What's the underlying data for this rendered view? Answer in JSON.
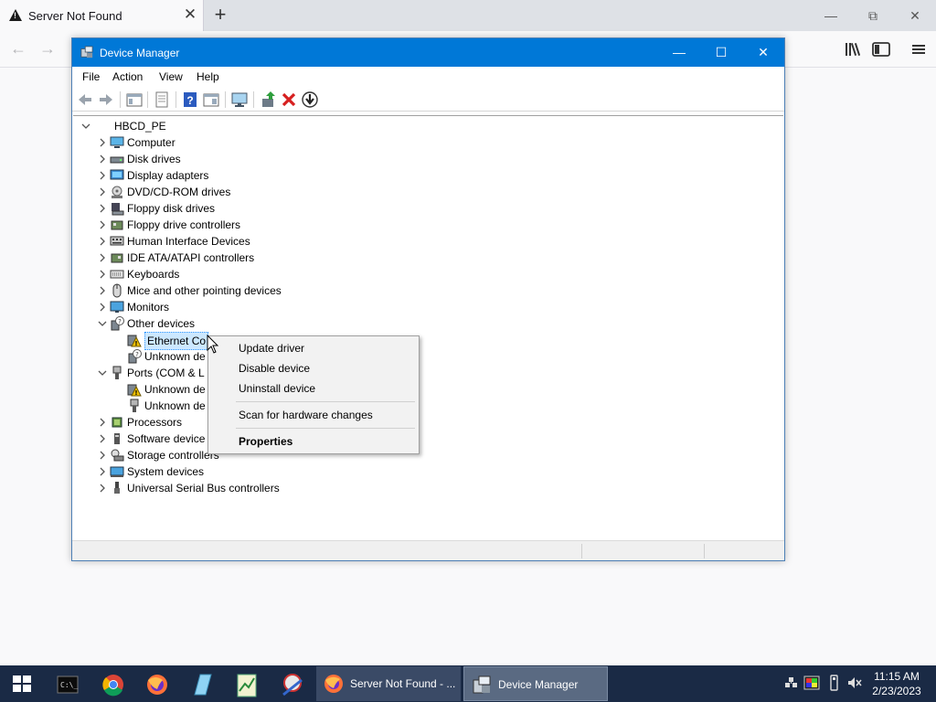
{
  "browser": {
    "tab_title": "Server Not Found",
    "tab_close": "✕",
    "new_tab": "+",
    "back": "←",
    "forward": "→"
  },
  "window": {
    "title": "Device Manager",
    "minimize": "—",
    "maximize": "☐",
    "close": "✕"
  },
  "menubar": [
    "File",
    "Action",
    "View",
    "Help"
  ],
  "tree": {
    "root": "HBCD_PE",
    "items": [
      {
        "label": "Computer",
        "icon": "computer-icon",
        "expanded": false
      },
      {
        "label": "Disk drives",
        "icon": "disk-drive-icon",
        "expanded": false
      },
      {
        "label": "Display adapters",
        "icon": "display-adapter-icon",
        "expanded": false
      },
      {
        "label": "DVD/CD-ROM drives",
        "icon": "dvd-drive-icon",
        "expanded": false
      },
      {
        "label": "Floppy disk drives",
        "icon": "floppy-disk-icon",
        "expanded": false
      },
      {
        "label": "Floppy drive controllers",
        "icon": "floppy-controller-icon",
        "expanded": false
      },
      {
        "label": "Human Interface Devices",
        "icon": "hid-icon",
        "expanded": false
      },
      {
        "label": "IDE ATA/ATAPI controllers",
        "icon": "ide-controller-icon",
        "expanded": false
      },
      {
        "label": "Keyboards",
        "icon": "keyboard-icon",
        "expanded": false
      },
      {
        "label": "Mice and other pointing devices",
        "icon": "mouse-icon",
        "expanded": false
      },
      {
        "label": "Monitors",
        "icon": "monitor-icon",
        "expanded": false
      },
      {
        "label": "Other devices",
        "icon": "unknown-device-icon",
        "expanded": true,
        "children": [
          {
            "label": "Ethernet Co",
            "icon": "warning-device-icon",
            "selected": true
          },
          {
            "label": "Unknown de",
            "icon": "unknown-device-icon"
          }
        ]
      },
      {
        "label": "Ports (COM & L",
        "icon": "port-icon",
        "expanded": true,
        "children": [
          {
            "label": "Unknown de",
            "icon": "warning-device-icon"
          },
          {
            "label": "Unknown de",
            "icon": "port-icon"
          }
        ]
      },
      {
        "label": "Processors",
        "icon": "processor-icon",
        "expanded": false
      },
      {
        "label": "Software device",
        "icon": "software-device-icon",
        "expanded": false
      },
      {
        "label": "Storage controllers",
        "icon": "storage-controller-icon",
        "expanded": false
      },
      {
        "label": "System devices",
        "icon": "system-device-icon",
        "expanded": false
      },
      {
        "label": "Universal Serial Bus controllers",
        "icon": "usb-icon",
        "expanded": false
      }
    ]
  },
  "context_menu": {
    "update": "Update driver",
    "disable": "Disable device",
    "uninstall": "Uninstall device",
    "scan": "Scan for hardware changes",
    "properties": "Properties"
  },
  "taskbar": {
    "tasks": [
      {
        "label": "Server Not Found - ...",
        "icon": "firefox-icon"
      },
      {
        "label": "Device Manager",
        "icon": "device-manager-icon"
      }
    ],
    "clock_time": "11:15 AM",
    "clock_date": "2/23/2023"
  },
  "colors": {
    "titlebar": "#0078d7",
    "taskbar": "#1a2a45",
    "selection": "#cce8ff",
    "warning": "#f2c200"
  }
}
